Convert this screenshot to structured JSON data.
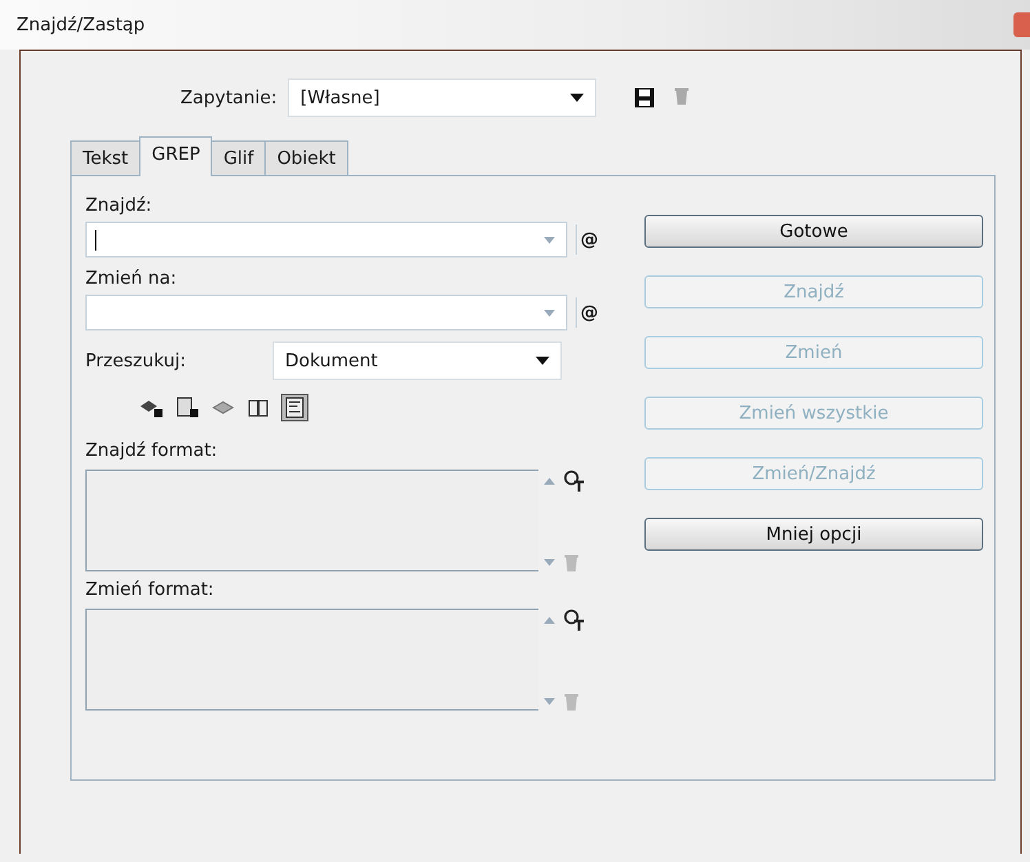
{
  "window": {
    "title": "Znajdź/Zastąp"
  },
  "query": {
    "label": "Zapytanie:",
    "value": "[Własne]"
  },
  "tabs": [
    {
      "label": "Tekst",
      "selected": false
    },
    {
      "label": "GREP",
      "selected": true
    },
    {
      "label": "Glif",
      "selected": false
    },
    {
      "label": "Obiekt",
      "selected": false
    }
  ],
  "find": {
    "label": "Znajdź:",
    "special": "@"
  },
  "change_to": {
    "label": "Zmień na:",
    "special": "@"
  },
  "search": {
    "label": "Przeszukuj:",
    "value": "Dokument"
  },
  "search_options": [
    {
      "kind": "locked-layers",
      "on": false
    },
    {
      "kind": "locked-stories",
      "on": false
    },
    {
      "kind": "hidden-layers",
      "on": false
    },
    {
      "kind": "master-pages",
      "on": false
    },
    {
      "kind": "footnotes",
      "on": true
    }
  ],
  "find_format": {
    "label": "Znajdź format:"
  },
  "change_format": {
    "label": "Zmień format:"
  },
  "buttons": [
    {
      "label": "Gotowe",
      "disabled": false
    },
    {
      "label": "Znajdź",
      "disabled": true
    },
    {
      "label": "Zmień",
      "disabled": true
    },
    {
      "label": "Zmień wszystkie",
      "disabled": true
    },
    {
      "label": "Zmień/Znajdź",
      "disabled": true
    },
    {
      "label": "Mniej opcji",
      "disabled": false
    }
  ]
}
